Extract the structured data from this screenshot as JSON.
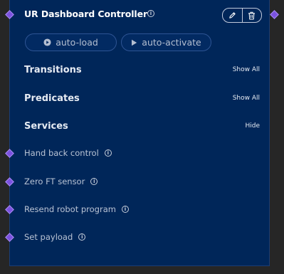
{
  "node": {
    "title": "UR Dashboard Controller",
    "accent_color": "#7b52e0",
    "background_color": "#002659"
  },
  "toolbar": {
    "edit_icon": "pencil-icon",
    "delete_icon": "trash-icon"
  },
  "actions": {
    "auto_load_label": "auto-load",
    "auto_activate_label": "auto-activate"
  },
  "sections": {
    "transitions": {
      "title": "Transitions",
      "toggle_label": "Show All"
    },
    "predicates": {
      "title": "Predicates",
      "toggle_label": "Show All"
    },
    "services": {
      "title": "Services",
      "toggle_label": "Hide"
    }
  },
  "services": [
    {
      "label": "Hand back control"
    },
    {
      "label": "Zero FT sensor"
    },
    {
      "label": "Resend robot program"
    },
    {
      "label": "Set payload"
    }
  ]
}
